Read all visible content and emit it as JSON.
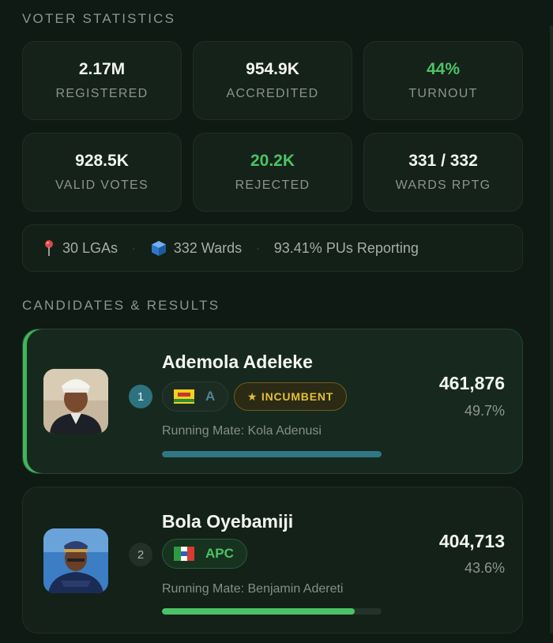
{
  "voter_statistics": {
    "title": "VOTER STATISTICS",
    "stats": [
      {
        "value": "2.17M",
        "label": "REGISTERED"
      },
      {
        "value": "954.9K",
        "label": "ACCREDITED"
      },
      {
        "value": "44%",
        "label": "TURNOUT"
      },
      {
        "value": "928.5K",
        "label": "VALID VOTES"
      },
      {
        "value": "20.2K",
        "label": "REJECTED"
      },
      {
        "value": "331 / 332",
        "label": "WARDS RPTG"
      }
    ],
    "accent_color": "#4cc266"
  },
  "info_bar": {
    "lgas": "30 LGAs",
    "wards": "332 Wards",
    "pus_reporting": "93.41% PUs Reporting",
    "separator": "·",
    "icons": [
      "pin-icon",
      "ballot-box-icon"
    ]
  },
  "candidates": {
    "title": "CANDIDATES & RESULTS",
    "items": [
      {
        "rank": "1",
        "name": "Ademola Adeleke",
        "party": "A",
        "badge": "★ INCUMBENT",
        "running_mate": "Running Mate: Kola Adenusi",
        "votes": "461,876",
        "percent": "49.7%",
        "bar_fraction": 1.0,
        "bar_color": "#2f7783",
        "leader_accent": "#3fb65a"
      },
      {
        "rank": "2",
        "name": "Bola Oyebamiji",
        "party": "APC",
        "running_mate": "Running Mate: Benjamin Adereti",
        "votes": "404,713",
        "percent": "43.6%",
        "bar_fraction": 0.877,
        "bar_color": "#4cc266"
      }
    ]
  },
  "colors": {
    "background": "#0f1a14",
    "incumbent_gold": "#e3bf35"
  }
}
